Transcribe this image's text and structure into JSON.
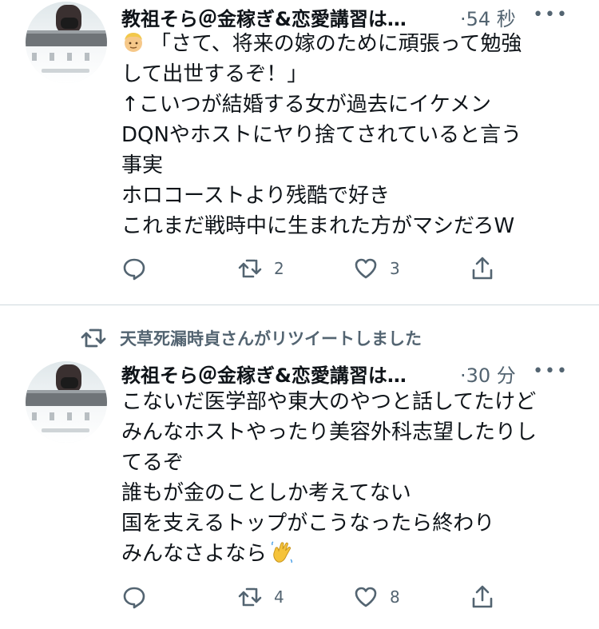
{
  "colors": {
    "text": "#0f1419",
    "muted": "#536471",
    "divider": "#cfd9de"
  },
  "retweet_notice": {
    "icon": "retweet-icon",
    "text": "天草死漏時貞さんがリツイートしました"
  },
  "tweets": [
    {
      "author": "教祖そら＠金稼ぎ&恋愛講習は…",
      "time": "54 秒",
      "more_icon": "more-icon",
      "lines": [
        "「さて、将来の嫁のために頑張って勉強",
        "して出世するぞ！」",
        "↑こいつが結婚する女が過去にイケメン",
        "DQNやホストにヤり捨てされていると言う",
        "事実",
        "ホロコーストより残酷で好き",
        "これまだ戦時中に生まれた方がマシだろW"
      ],
      "reply_icon": "reply-icon",
      "retweets": "2",
      "likes": "3",
      "share_icon": "share-icon"
    },
    {
      "author": "教祖そら＠金稼ぎ&恋愛講習は…",
      "time": "30 分",
      "more_icon": "more-icon",
      "lines": [
        "こないだ医学部や東大のやつと話してたけど",
        "みんなホストやったり美容外科志望したりし",
        "てるぞ",
        "誰もが金のことしか考えてない",
        "国を支えるトップがこうなったら終わり",
        "みんなさよなら"
      ],
      "reply_icon": "reply-icon",
      "retweets": "4",
      "likes": "8",
      "share_icon": "share-icon"
    }
  ]
}
